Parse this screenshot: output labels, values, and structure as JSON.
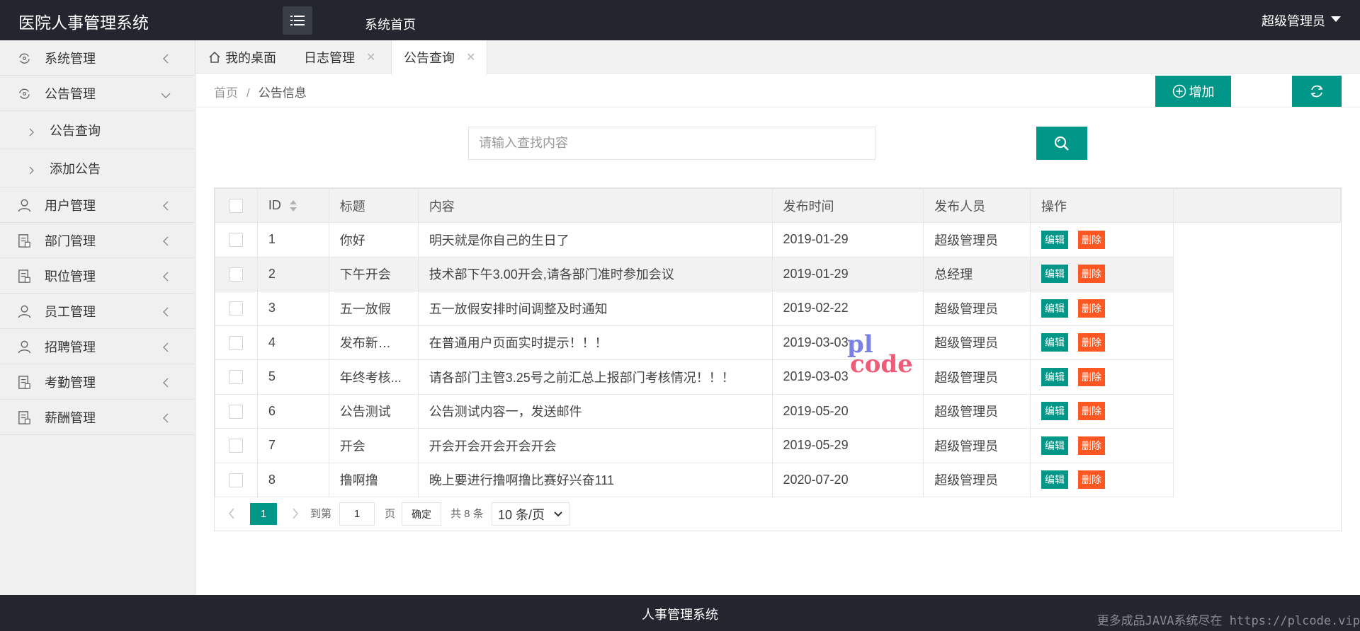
{
  "app": {
    "title": "医院人事管理系统",
    "home_link": "系统首页",
    "user": "超级管理员"
  },
  "sidebar": {
    "items": [
      {
        "label": "系统管理",
        "icon": "refresh-shield-icon"
      },
      {
        "label": "公告管理",
        "icon": "refresh-shield-icon",
        "expanded": true,
        "children": [
          {
            "label": "公告查询"
          },
          {
            "label": "添加公告"
          }
        ]
      },
      {
        "label": "用户管理",
        "icon": "user-icon"
      },
      {
        "label": "部门管理",
        "icon": "document-icon"
      },
      {
        "label": "职位管理",
        "icon": "document-icon"
      },
      {
        "label": "员工管理",
        "icon": "user-icon"
      },
      {
        "label": "招聘管理",
        "icon": "user-icon"
      },
      {
        "label": "考勤管理",
        "icon": "document-icon"
      },
      {
        "label": "薪酬管理",
        "icon": "document-icon"
      }
    ]
  },
  "tabs": [
    {
      "label": "我的桌面",
      "icon": "home-icon",
      "closable": false
    },
    {
      "label": "日志管理",
      "closable": true
    },
    {
      "label": "公告查询",
      "closable": true,
      "active": true
    }
  ],
  "breadcrumb": {
    "home": "首页",
    "sep": "/",
    "current": "公告信息"
  },
  "toolbar": {
    "add_label": "增加"
  },
  "search": {
    "placeholder": "请输入查找内容"
  },
  "table": {
    "columns": [
      "ID",
      "标题",
      "内容",
      "发布时间",
      "发布人员",
      "操作"
    ],
    "edit_label": "编辑",
    "delete_label": "删除",
    "rows": [
      {
        "id": "1",
        "title": "你好",
        "content": "明天就是你自己的生日了",
        "time": "2019-01-29",
        "author": "超级管理员"
      },
      {
        "id": "2",
        "title": "下午开会",
        "content": "技术部下午3.00开会,请各部门准时参加会议",
        "time": "2019-01-29",
        "author": "总经理"
      },
      {
        "id": "3",
        "title": "五一放假",
        "content": "五一放假安排时间调整及时通知",
        "time": "2019-02-22",
        "author": "超级管理员"
      },
      {
        "id": "4",
        "title": "发布新消息",
        "content": "在普通用户页面实时提示！！！",
        "time": "2019-03-03",
        "author": "超级管理员"
      },
      {
        "id": "5",
        "title": "年终考核...",
        "content": "请各部门主管3.25号之前汇总上报部门考核情况！！！",
        "time": "2019-03-03",
        "author": "超级管理员"
      },
      {
        "id": "6",
        "title": "公告测试",
        "content": "公告测试内容一，发送邮件",
        "time": "2019-05-20",
        "author": "超级管理员"
      },
      {
        "id": "7",
        "title": "开会",
        "content": "开会开会开会开会开会",
        "time": "2019-05-29",
        "author": "超级管理员"
      },
      {
        "id": "8",
        "title": "撸啊撸",
        "content": "晚上要进行撸啊撸比赛好兴奋111",
        "time": "2020-07-20",
        "author": "超级管理员"
      }
    ]
  },
  "pager": {
    "current": "1",
    "goto_label": "到第",
    "page_value": "1",
    "page_label": "页",
    "ok_label": "确定",
    "total": "共 8 条",
    "page_size": "10 条/页"
  },
  "watermark": {
    "line1": "pl",
    "line2": "code"
  },
  "footer": {
    "title": "人事管理系统",
    "note": "更多成品JAVA系统尽在 https://plcode.vip"
  },
  "colors": {
    "accent": "#009688",
    "danger": "#ff5722",
    "header_bg": "#23262e"
  }
}
